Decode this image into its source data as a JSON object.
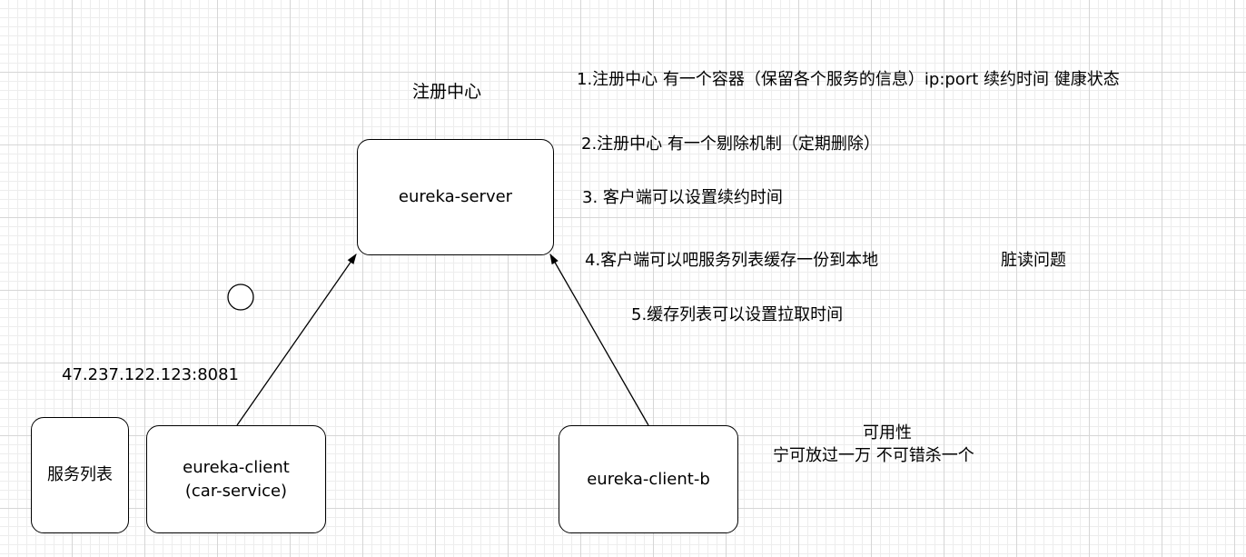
{
  "title": "注册中心",
  "nodes": {
    "server": "eureka-server",
    "client_line1": "eureka-client",
    "client_line2": "(car-service)",
    "client_b": "eureka-client-b",
    "service_list": "服务列表"
  },
  "address": "47.237.122.123:8081",
  "notes": [
    "1.注册中心 有一个容器（保留各个服务的信息）ip:port  续约时间  健康状态",
    "2.注册中心 有一个剔除机制（定期删除）",
    "3. 客户端可以设置续约时间",
    "4.客户端可以吧服务列表缓存一份到本地",
    "脏读问题",
    "5.缓存列表可以设置拉取时间"
  ],
  "availability": {
    "heading": "可用性",
    "motto": "宁可放过一万 不可错杀一个"
  }
}
